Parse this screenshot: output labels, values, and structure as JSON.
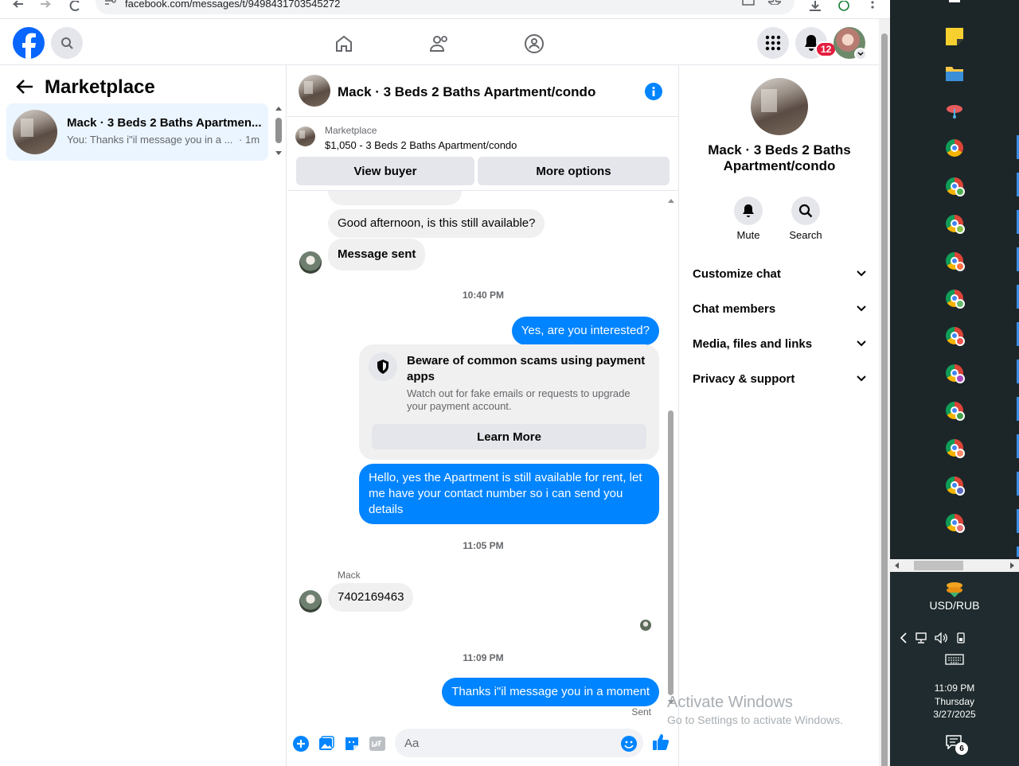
{
  "browser": {
    "url": "facebook.com/messages/t/9498431703545272"
  },
  "header": {
    "notifications_count": "12"
  },
  "left_panel": {
    "title": "Marketplace",
    "conversation": {
      "name": "Mack · 3 Beds 2 Baths Apartmen...",
      "preview": "You: Thanks i\"il message you in a ...",
      "time": "· 1m"
    }
  },
  "chat": {
    "title": "Mack · 3 Beds 2 Baths Apartment/condo",
    "marketplace_label": "Marketplace",
    "listing": "$1,050 - 3 Beds 2 Baths Apartment/condo",
    "view_buyer": "View buyer",
    "more_options": "More options",
    "messages": {
      "m1": "Good afternoon, is this still available?",
      "m2": "Message sent",
      "ts1": "10:40 PM",
      "m3": "Yes, are you interested?",
      "scam_title": "Beware of common scams using payment apps",
      "scam_body": "Watch out for fake emails or requests to upgrade your payment account.",
      "scam_button": "Learn More",
      "m4": "Hello, yes the Apartment is still available for rent, let me have your contact number so i can send you details",
      "ts2": "11:05 PM",
      "sender": "Mack",
      "m5": "7402169463",
      "ts3": "11:09 PM",
      "m6": "Thanks i\"il message you in a moment",
      "status": "Sent"
    },
    "input_placeholder": "Aa"
  },
  "right_panel": {
    "name": "Mack · 3 Beds 2 Baths Apartment/condo",
    "mute": "Mute",
    "search": "Search",
    "sections": [
      "Customize chat",
      "Chat members",
      "Media, files and links",
      "Privacy & support"
    ]
  },
  "taskbar": {
    "currency": "USD/RUB",
    "time": "11:09 PM",
    "day": "Thursday",
    "date": "3/27/2025",
    "notif_count": "6"
  },
  "watermark": {
    "line1": "Activate Windows",
    "line2": "Go to Settings to activate Windows."
  },
  "colors": {
    "accent": "#0084ff",
    "fb_blue": "#0866ff",
    "badge": "#e41e3f"
  }
}
